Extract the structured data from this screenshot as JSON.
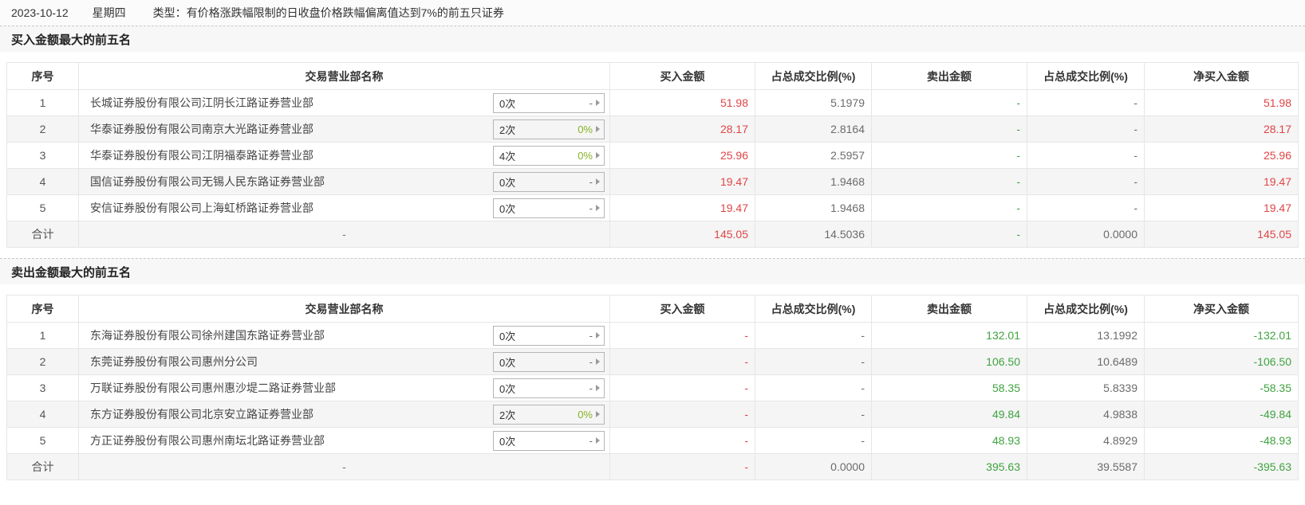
{
  "topbar": {
    "date": "2023-10-12",
    "weekday": "星期四",
    "type_text": "类型：有价格涨跌幅限制的日收盘价格跌幅偏离值达到7%的前五只证券"
  },
  "columns": {
    "no": "序号",
    "name": "交易营业部名称",
    "buy": "买入金额",
    "buy_ratio": "占总成交比例(%)",
    "sell": "卖出金额",
    "sell_ratio": "占总成交比例(%)",
    "net": "净买入金额"
  },
  "total_label": "合计",
  "colors": {
    "red": "#e04545",
    "green": "#3fa33f",
    "olive_rate": "#86b225",
    "muted": "#6b6b6b"
  },
  "buy": {
    "title": "买入金额最大的前五名",
    "rows": [
      {
        "no": "1",
        "name": "长城证券股份有限公司江阴长江路证券营业部",
        "visit_count": "0次",
        "visit_rate": "-",
        "rate_class": "muted",
        "buy": "51.98",
        "buy_ratio": "5.1979",
        "sell": "-",
        "sell_ratio": "-",
        "net": "51.98",
        "net_class": "red"
      },
      {
        "no": "2",
        "name": "华泰证券股份有限公司南京大光路证券营业部",
        "visit_count": "2次",
        "visit_rate": "0%",
        "rate_class": "olv",
        "buy": "28.17",
        "buy_ratio": "2.8164",
        "sell": "-",
        "sell_ratio": "-",
        "net": "28.17",
        "net_class": "red"
      },
      {
        "no": "3",
        "name": "华泰证券股份有限公司江阴福泰路证券营业部",
        "visit_count": "4次",
        "visit_rate": "0%",
        "rate_class": "olv",
        "buy": "25.96",
        "buy_ratio": "2.5957",
        "sell": "-",
        "sell_ratio": "-",
        "net": "25.96",
        "net_class": "red"
      },
      {
        "no": "4",
        "name": "国信证券股份有限公司无锡人民东路证券营业部",
        "visit_count": "0次",
        "visit_rate": "-",
        "rate_class": "muted",
        "buy": "19.47",
        "buy_ratio": "1.9468",
        "sell": "-",
        "sell_ratio": "-",
        "net": "19.47",
        "net_class": "red"
      },
      {
        "no": "5",
        "name": "安信证券股份有限公司上海虹桥路证券营业部",
        "visit_count": "0次",
        "visit_rate": "-",
        "rate_class": "muted",
        "buy": "19.47",
        "buy_ratio": "1.9468",
        "sell": "-",
        "sell_ratio": "-",
        "net": "19.47",
        "net_class": "red"
      }
    ],
    "total": {
      "name": "-",
      "buy": "145.05",
      "buy_ratio": "14.5036",
      "sell": "-",
      "sell_ratio": "0.0000",
      "net": "145.05",
      "net_class": "red"
    }
  },
  "sell": {
    "title": "卖出金额最大的前五名",
    "rows": [
      {
        "no": "1",
        "name": "东海证券股份有限公司徐州建国东路证券营业部",
        "visit_count": "0次",
        "visit_rate": "-",
        "rate_class": "muted",
        "buy": "-",
        "buy_ratio": "-",
        "sell": "132.01",
        "sell_ratio": "13.1992",
        "net": "-132.01",
        "net_class": "green"
      },
      {
        "no": "2",
        "name": "东莞证券股份有限公司惠州分公司",
        "visit_count": "0次",
        "visit_rate": "-",
        "rate_class": "muted",
        "buy": "-",
        "buy_ratio": "-",
        "sell": "106.50",
        "sell_ratio": "10.6489",
        "net": "-106.50",
        "net_class": "green"
      },
      {
        "no": "3",
        "name": "万联证券股份有限公司惠州惠沙堤二路证券营业部",
        "visit_count": "0次",
        "visit_rate": "-",
        "rate_class": "muted",
        "buy": "-",
        "buy_ratio": "-",
        "sell": "58.35",
        "sell_ratio": "5.8339",
        "net": "-58.35",
        "net_class": "green"
      },
      {
        "no": "4",
        "name": "东方证券股份有限公司北京安立路证券营业部",
        "visit_count": "2次",
        "visit_rate": "0%",
        "rate_class": "olv",
        "buy": "-",
        "buy_ratio": "-",
        "sell": "49.84",
        "sell_ratio": "4.9838",
        "net": "-49.84",
        "net_class": "green"
      },
      {
        "no": "5",
        "name": "方正证券股份有限公司惠州南坛北路证券营业部",
        "visit_count": "0次",
        "visit_rate": "-",
        "rate_class": "muted",
        "buy": "-",
        "buy_ratio": "-",
        "sell": "48.93",
        "sell_ratio": "4.8929",
        "net": "-48.93",
        "net_class": "green"
      }
    ],
    "total": {
      "name": "-",
      "buy": "-",
      "buy_ratio": "0.0000",
      "sell": "395.63",
      "sell_ratio": "39.5587",
      "net": "-395.63",
      "net_class": "green"
    }
  }
}
